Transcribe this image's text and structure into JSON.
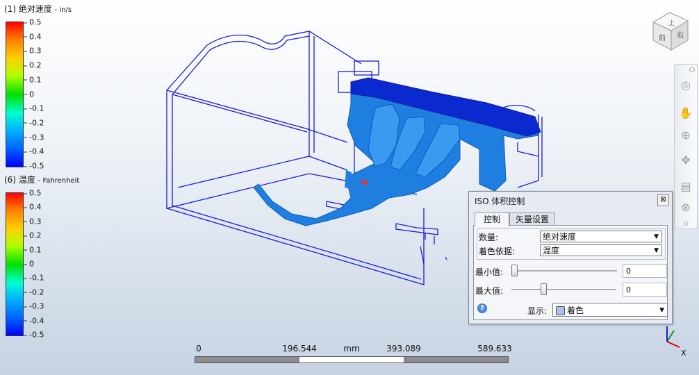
{
  "legend_velocity": {
    "title": "(1) 绝对速度",
    "unit": "- in/s",
    "ticks": [
      "0.5",
      "0.4",
      "0.3",
      "0.2",
      "0.1",
      "0",
      "-0.1",
      "-0.2",
      "-0.3",
      "-0.4",
      "-0.5"
    ]
  },
  "legend_temperature": {
    "title": "(6) 温度",
    "unit": "- Fahrenheit",
    "ticks": [
      "0.5",
      "0.4",
      "0.3",
      "0.2",
      "0.1",
      "0",
      "-0.1",
      "-0.2",
      "-0.3",
      "-0.4",
      "-0.5"
    ]
  },
  "viewcube": {
    "top_face": "上",
    "front_face": "前",
    "right_face": "右"
  },
  "navbar": {
    "icons": [
      "steering-wheel-icon",
      "pan-icon",
      "zoom-icon",
      "orbit-icon",
      "rewind-icon",
      "center-icon"
    ]
  },
  "scale_bar": {
    "labels": [
      "0",
      "196.544",
      "393.089",
      "589.633"
    ],
    "unit": "mm"
  },
  "dialog": {
    "title": "ISO 体积控制",
    "close_label": "⊠",
    "tabs": [
      "控制",
      "矢量设置"
    ],
    "quantity_label": "数量:",
    "quantity_value": "绝对速度",
    "color_by_label": "着色依据:",
    "color_by_value": "温度",
    "min_label": "最小值:",
    "min_value": "0",
    "min_fraction": 0.0,
    "max_label": "最大值:",
    "max_value": "0",
    "max_fraction": 0.3,
    "display_label": "显示:",
    "display_value": "着色",
    "help_label": "?"
  },
  "colors": {
    "wireframe": "#1a1adc",
    "isosurface": "#1f7fe0",
    "isosurface_dark": "#0a2ad0"
  }
}
